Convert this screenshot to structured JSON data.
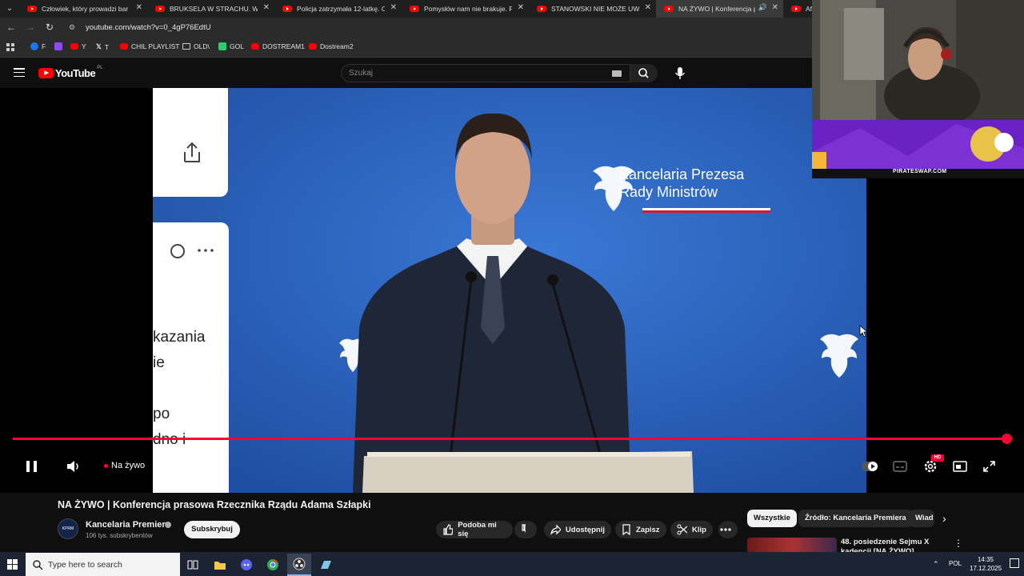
{
  "browser": {
    "tabs": [
      {
        "label": "Człowiek, który prowadzi bar m",
        "active": false
      },
      {
        "label": "BRUKSELA W STRACHU. WOJN",
        "active": false
      },
      {
        "label": "Policja zatrzymała 12-latkę. Co",
        "active": false
      },
      {
        "label": "Pomysłów nam nie brakuje. Po",
        "active": false
      },
      {
        "label": "STANOWSKI NIE MOŻE UWIER",
        "active": false
      },
      {
        "label": "NA ŻYWO | Konferencja pr",
        "active": true
      },
      {
        "label": "Afer",
        "active": false
      }
    ],
    "url": "youtube.com/watch?v=0_4gP76EdtU",
    "bookmarks": [
      "F",
      "",
      "Y",
      "T",
      "CHIL PLAYLIST",
      "OLD\\",
      "GOL",
      "DOSTREAM1",
      "Dostream2"
    ]
  },
  "youtube": {
    "region_badge": "PL",
    "logo_text": "YouTube",
    "search_placeholder": "Szukaj"
  },
  "video_frame": {
    "card_text_lines": [
      "kazania",
      "ie",
      "",
      "po",
      "dno i"
    ],
    "backdrop_text_line1": "Kancelaria Prezesa",
    "backdrop_text_line2": "Rady Ministrów"
  },
  "player": {
    "live_label": "Na żywo",
    "hd_badge": "HD",
    "progress_fraction": 1.0
  },
  "video": {
    "title": "NA ŻYWO | Konferencja prasowa Rzecznika Rządu Adama Szłapki",
    "channel_name": "Kancelaria Premiera",
    "channel_avatar_text": "KPRM",
    "subscribers": "106 tys. subskrybentów",
    "subscribe_label": "Subskrybuj",
    "actions": {
      "like": "Podoba mi się",
      "share": "Udostępnij",
      "save": "Zapisz",
      "clip": "Klip"
    }
  },
  "sidebar": {
    "chips": [
      "Wszystkie",
      "Źródło: Kancelaria Premiera",
      "Wiad"
    ],
    "recommended": [
      {
        "title": "48. posiedzenie Sejmu X kadencji [NA ŻYWO]"
      }
    ]
  },
  "overlay": {
    "banner_text": "PIRATESWAP.COM"
  },
  "taskbar": {
    "search_placeholder": "Type here to search",
    "language": "POL",
    "time": "14:35",
    "date": "17.12.2025"
  },
  "colors": {
    "youtube_red": "#ff0000",
    "progress_red": "#ff0033",
    "video_blue": "#2a5fb5"
  }
}
